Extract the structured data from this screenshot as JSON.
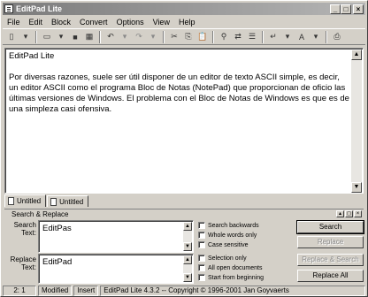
{
  "window": {
    "title": "EditPad Lite",
    "min": "_",
    "max": "□",
    "close": "×"
  },
  "menu": [
    "File",
    "Edit",
    "Block",
    "Convert",
    "Options",
    "View",
    "Help"
  ],
  "toolbar": {
    "new": "▯",
    "dd1": "▾",
    "open": "▭",
    "dd2": "▾",
    "save": "■",
    "saveall": "▦",
    "undo": "↶",
    "undo_dd": "▾",
    "redo": "↷",
    "redo_dd": "▾",
    "cut": "✂",
    "copy": "⎘",
    "paste": "📋",
    "find": "⚲",
    "replace": "⇄",
    "goto": "☰",
    "wrap": "↵",
    "wrap_dd": "▾",
    "case": "A",
    "case_dd": "▾",
    "print": "⎙"
  },
  "editor": {
    "text": "EditPad Lite\n\nPor diversas razones, suele ser útil disponer de un editor de texto ASCII simple, es decir, un editor ASCII como el programa Bloc de Notas (NotePad) que proporcionan de oficio las últimas versiones de Windows. El problema con el Bloc de Notas de Windows es que es de una simpleza casi ofensiva."
  },
  "scroll": {
    "up": "▲",
    "down": "▼"
  },
  "tabs": [
    {
      "label": "Untitled"
    },
    {
      "label": "Untitled"
    }
  ],
  "search_panel": {
    "title": "Search & Replace",
    "search_label": "Search Text:",
    "search_value": "EditPas",
    "replace_label": "Replace Text:",
    "replace_value": "EditPad",
    "options": [
      "Search backwards",
      "Whole words only",
      "Case sensitive",
      "Selection only",
      "All open documents",
      "Start from beginning"
    ],
    "buttons": {
      "search": "Search",
      "replace": "Replace",
      "replace_search": "Replace & Search",
      "replace_all": "Replace All"
    }
  },
  "status": {
    "position": "2: 1",
    "modified": "Modified",
    "mode": "Insert",
    "version": "EditPad Lite 4.3.2 -- Copyright © 1996-2001 Jan Goyvaerts"
  }
}
